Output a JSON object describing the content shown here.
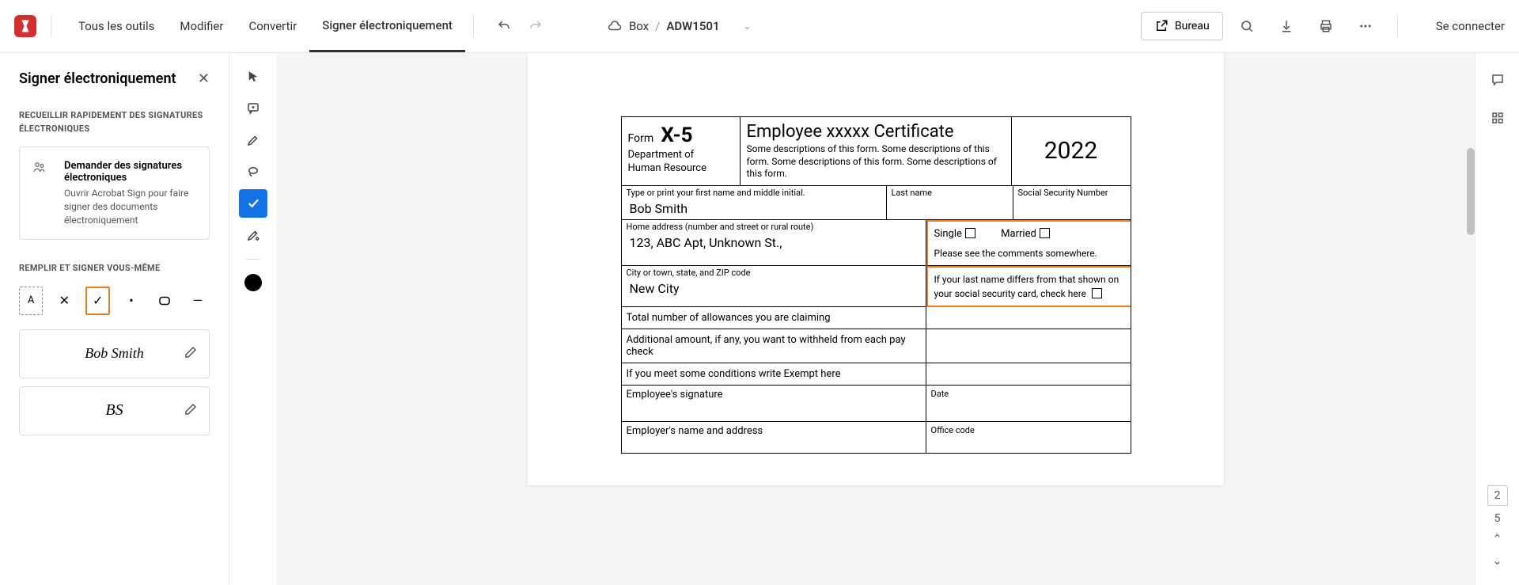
{
  "top": {
    "all_tools": "Tous les outils",
    "edit": "Modifier",
    "convert": "Convertir",
    "sign": "Signer électroniquement",
    "location_service": "Box",
    "doc_name": "ADW1501",
    "bureau": "Bureau",
    "login": "Se connecter"
  },
  "panel": {
    "title": "Signer électroniquement",
    "section1": "RECUEILLIR RAPIDEMENT DES SIGNATURES ÉLECTRONIQUES",
    "card_title": "Demander des signatures électroniques",
    "card_desc": "Ouvrir Acrobat Sign pour faire signer des documents électroniquement",
    "section2": "REMPLIR ET SIGNER VOUS-MÊME",
    "signature_name": "Bob Smith",
    "initials": "BS"
  },
  "form": {
    "form_label": "Form",
    "form_code": "X-5",
    "dept1": "Department of",
    "dept2": "Human Resource",
    "title": "Employee xxxxx Certificate",
    "desc": "Some descriptions of this form. Some descriptions of this form. Some descriptions of this form. Some descriptions of this form.",
    "year": "2022",
    "first_name_label": "Type or print your first name and middle initial.",
    "first_name_value": "Bob Smith",
    "last_name_label": "Last name",
    "ssn_label": "Social Security Number",
    "address_label": "Home address (number and street or rural route)",
    "address_value": "123, ABC Apt, Unknown St.,",
    "single": "Single",
    "married": "Married",
    "marital_note": "Please see the comments somewhere.",
    "city_label": "City or town, state, and ZIP code",
    "city_value": "New City",
    "name_differ": "If your last name differs from that shown on your social security card, check here",
    "allowances": "Total number of allowances you are claiming",
    "additional": "Additional amount, if any, you want to withheld from each pay check",
    "exempt": "If you meet some conditions write Exempt here",
    "emp_sig": "Employee's signature",
    "date": "Date",
    "employer": "Employer's name and address",
    "office": "Office code"
  },
  "pages": {
    "current": "2",
    "total": "5"
  }
}
